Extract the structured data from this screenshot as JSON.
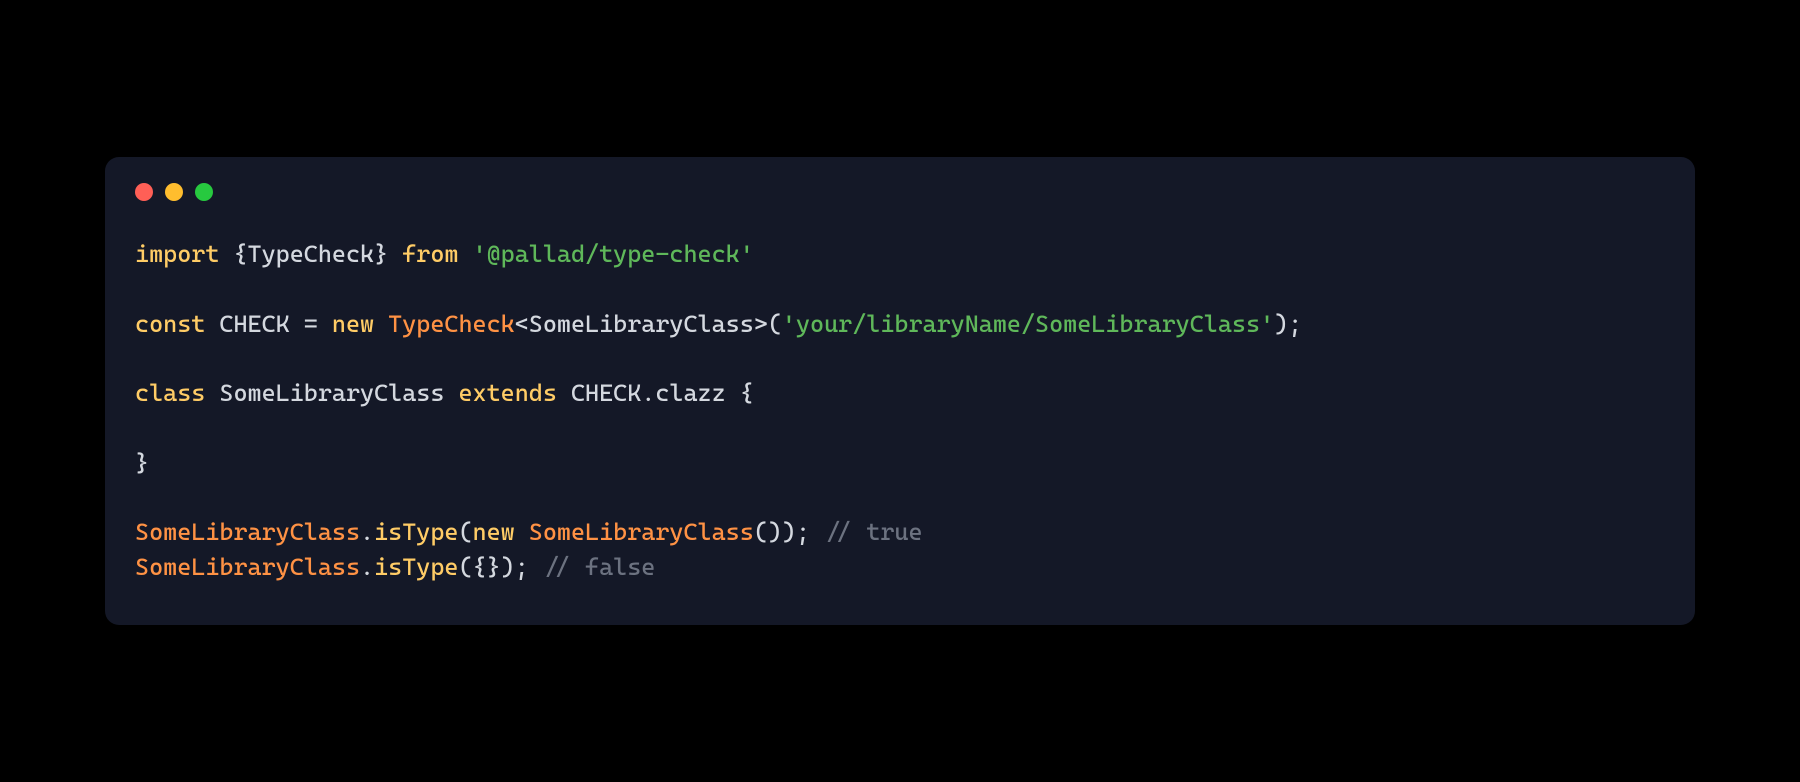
{
  "window": {
    "buttons": [
      "close",
      "minimize",
      "zoom"
    ]
  },
  "code": {
    "line1": {
      "kw_import": "import",
      "brace_open": "{",
      "imported": "TypeCheck",
      "brace_close": "}",
      "kw_from": "from",
      "module": "'@pallad/type-check'"
    },
    "line2": {
      "kw_const": "const",
      "name": "CHECK",
      "eq": "=",
      "kw_new": "new",
      "ctor": "TypeCheck",
      "lt": "<",
      "generic": "SomeLibraryClass",
      "gt": ">",
      "lp": "(",
      "arg": "'your/libraryName/SomeLibraryClass'",
      "rp": ")",
      "semi": ";"
    },
    "line3": {
      "kw_class": "class",
      "name": "SomeLibraryClass",
      "kw_extends": "extends",
      "base_obj": "CHECK",
      "dot": ".",
      "base_prop": "clazz",
      "brace_open": "{"
    },
    "line4": {
      "brace_close": "}"
    },
    "line5": {
      "cls": "SomeLibraryClass",
      "dot1": ".",
      "method": "isType",
      "lp": "(",
      "kw_new": "new",
      "ctor": "SomeLibraryClass",
      "lp2": "(",
      "rp2": ")",
      "rp": ")",
      "semi": ";",
      "comment": "// true"
    },
    "line6": {
      "cls": "SomeLibraryClass",
      "dot1": ".",
      "method": "isType",
      "lp": "(",
      "obj_open": "{",
      "obj_close": "}",
      "rp": ")",
      "semi": ";",
      "comment": "// false"
    }
  }
}
